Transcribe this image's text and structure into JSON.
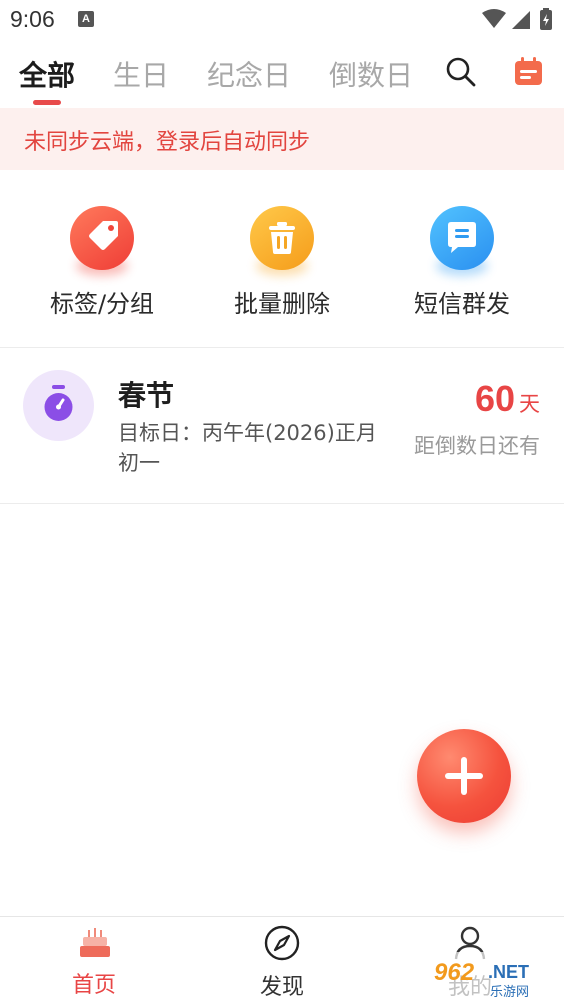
{
  "status_bar": {
    "time": "9:06",
    "notification_letter": "A"
  },
  "tabs": [
    {
      "label": "全部",
      "active": true
    },
    {
      "label": "生日",
      "active": false
    },
    {
      "label": "纪念日",
      "active": false
    },
    {
      "label": "倒数日",
      "active": false
    }
  ],
  "header_icons": {
    "search": "search-icon",
    "calendar": "calendar-icon"
  },
  "banner": {
    "text": "未同步云端，登录后自动同步"
  },
  "actions": [
    {
      "label": "标签/分组",
      "icon": "tag-icon",
      "color": "#f0453a"
    },
    {
      "label": "批量删除",
      "icon": "trash-icon",
      "color": "#f7a623"
    },
    {
      "label": "短信群发",
      "icon": "message-icon",
      "color": "#2f9bf2"
    }
  ],
  "event": {
    "title": "春节",
    "target": "目标日：丙午年(2026)正月初一",
    "count": "60",
    "unit": "天",
    "subtitle": "距倒数日还有",
    "icon": "stopwatch-icon"
  },
  "fab": {
    "icon": "plus-icon"
  },
  "bottom_nav": [
    {
      "label": "首页",
      "icon": "cake-icon",
      "active": true
    },
    {
      "label": "发现",
      "icon": "compass-icon",
      "active": false
    },
    {
      "label": "我的",
      "icon": "person-icon",
      "active": false
    }
  ],
  "watermark": {
    "brand": "962",
    "suffix": ".NET",
    "caption": "乐游网"
  },
  "colors": {
    "accent": "#e84545",
    "banner_bg": "#fdf0ee",
    "banner_text": "#e2453f"
  }
}
